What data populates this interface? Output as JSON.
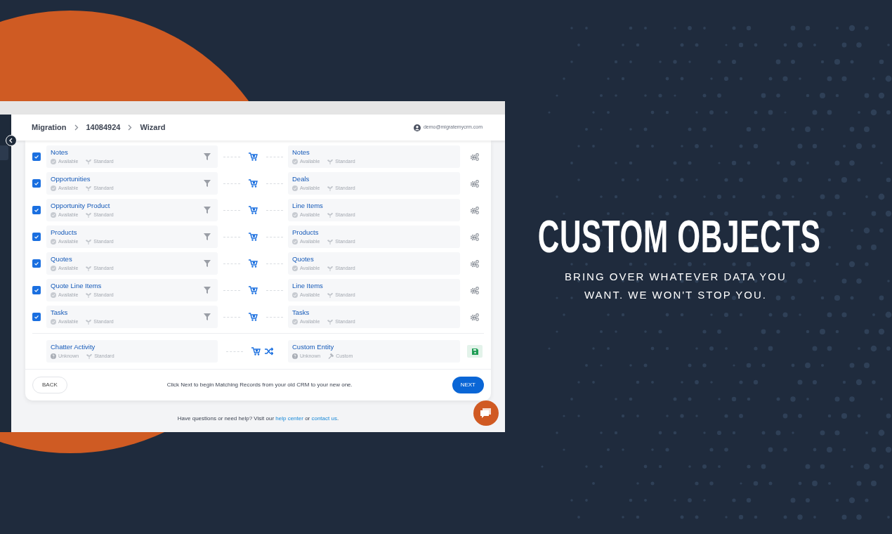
{
  "breadcrumb": [
    {
      "label": "Migration"
    },
    {
      "label": "14084924"
    },
    {
      "label": "Wizard"
    }
  ],
  "user": {
    "email": "demo@migratemycrm.com"
  },
  "rows": [
    {
      "kind": "mapped",
      "checked": true,
      "source": {
        "name": "Notes",
        "status": "Available",
        "known": true,
        "type": "Standard",
        "custom": false
      },
      "target": {
        "name": "Notes",
        "status": "Available",
        "known": true,
        "type": "Standard",
        "custom": false
      }
    },
    {
      "kind": "mapped",
      "checked": true,
      "source": {
        "name": "Opportunities",
        "status": "Available",
        "known": true,
        "type": "Standard",
        "custom": false
      },
      "target": {
        "name": "Deals",
        "status": "Available",
        "known": true,
        "type": "Standard",
        "custom": false
      }
    },
    {
      "kind": "mapped",
      "checked": true,
      "source": {
        "name": "Opportunity Product",
        "status": "Available",
        "known": true,
        "type": "Standard",
        "custom": false
      },
      "target": {
        "name": "Line Items",
        "status": "Available",
        "known": true,
        "type": "Standard",
        "custom": false
      }
    },
    {
      "kind": "mapped",
      "checked": true,
      "source": {
        "name": "Products",
        "status": "Available",
        "known": true,
        "type": "Standard",
        "custom": false
      },
      "target": {
        "name": "Products",
        "status": "Available",
        "known": true,
        "type": "Standard",
        "custom": false
      }
    },
    {
      "kind": "mapped",
      "checked": true,
      "source": {
        "name": "Quotes",
        "status": "Available",
        "known": true,
        "type": "Standard",
        "custom": false
      },
      "target": {
        "name": "Quotes",
        "status": "Available",
        "known": true,
        "type": "Standard",
        "custom": false
      }
    },
    {
      "kind": "mapped",
      "checked": true,
      "source": {
        "name": "Quote Line Items",
        "status": "Available",
        "known": true,
        "type": "Standard",
        "custom": false
      },
      "target": {
        "name": "Line Items",
        "status": "Available",
        "known": true,
        "type": "Standard",
        "custom": false
      }
    },
    {
      "kind": "mapped",
      "checked": true,
      "source": {
        "name": "Tasks",
        "status": "Available",
        "known": true,
        "type": "Standard",
        "custom": false
      },
      "target": {
        "name": "Tasks",
        "status": "Available",
        "known": true,
        "type": "Standard",
        "custom": false
      }
    },
    {
      "kind": "custom",
      "source": {
        "name": "Chatter Activity",
        "status": "Unknown",
        "known": false,
        "type": "Standard",
        "custom": false
      },
      "target": {
        "name": "Custom Entity",
        "status": "Unknown",
        "known": false,
        "type": "Custom",
        "custom": true
      }
    }
  ],
  "footer": {
    "back": "BACK",
    "message": "Click Next to begin Matching Records from your old CRM to your new one.",
    "next": "NEXT"
  },
  "help": {
    "text": "Have questions or need help? Visit our",
    "link1": "help center",
    "middle": "or",
    "link2": "contact us",
    "end": "."
  },
  "promo": {
    "title": "CUSTOM OBJECTS",
    "tagline": "BRING OVER WHATEVER DATA YOU WANT. WE WON'T STOP YOU."
  }
}
